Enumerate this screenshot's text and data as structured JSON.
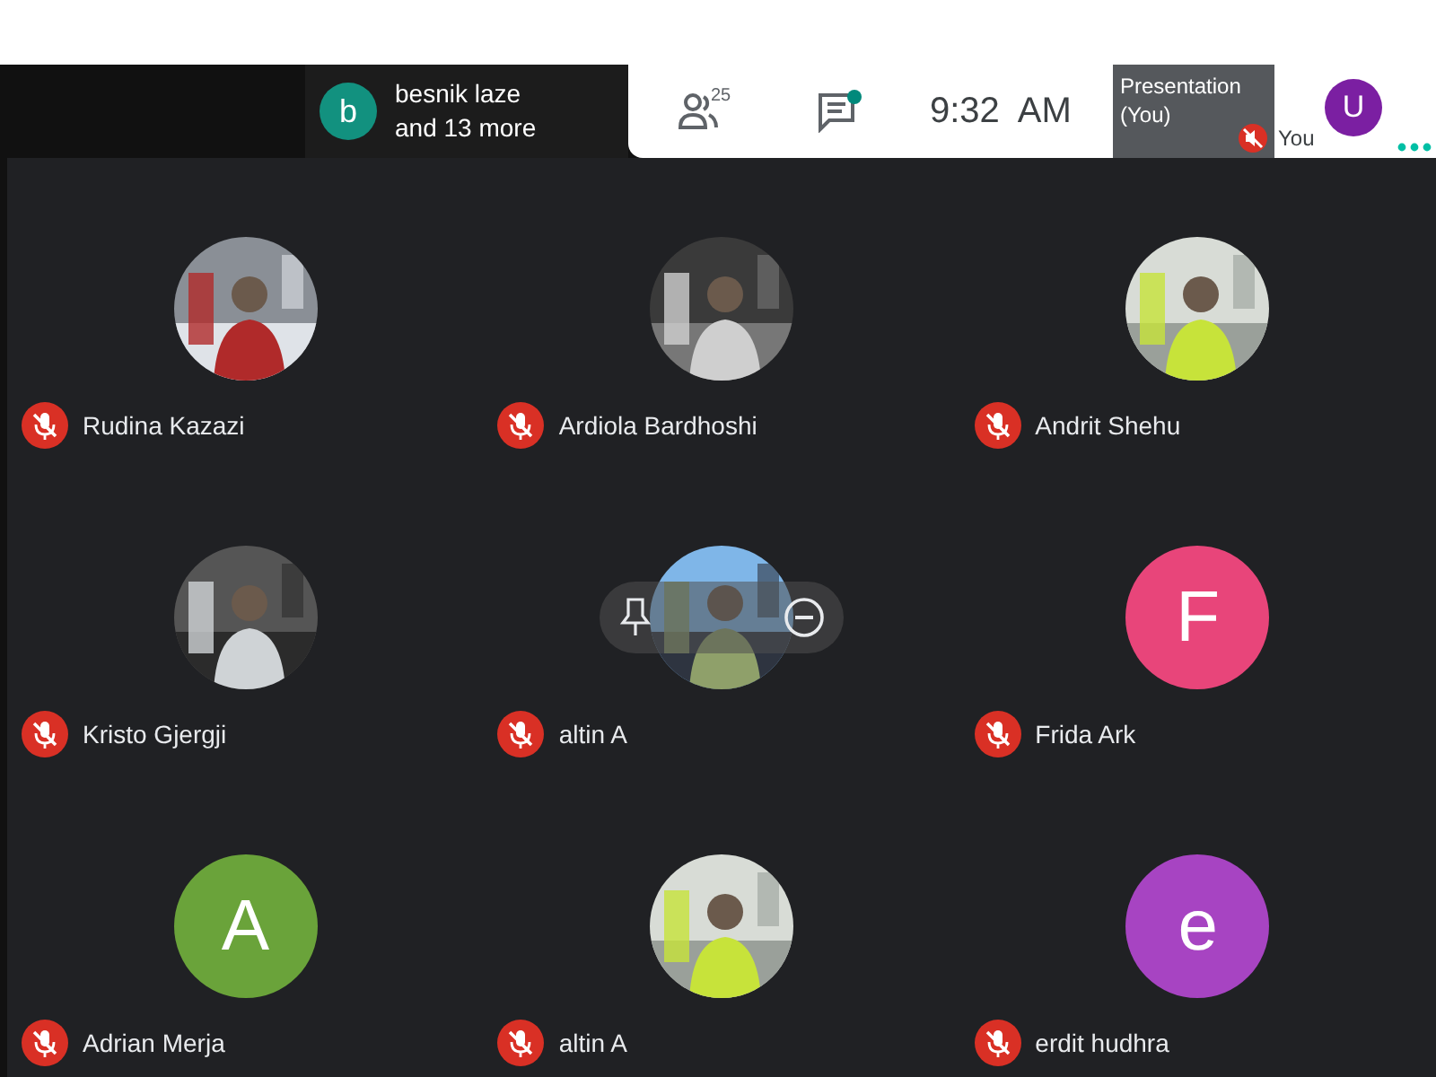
{
  "top_bar": {
    "presenter": {
      "initial": "b",
      "color": "#12917f",
      "line1": "besnik laze",
      "line2": "and 13 more"
    },
    "people_count": "25",
    "chat_unread": true,
    "time": "9:32  AM",
    "presentation": {
      "label": "Presentation\n(You)",
      "muted": true
    },
    "self": {
      "initial": "U",
      "color": "#7b1fa2",
      "label": "You"
    }
  },
  "participants": [
    {
      "name": "Rudina Kazazi",
      "muted": true,
      "hovered": false
    },
    {
      "name": "Ardiola Bardhoshi",
      "muted": true,
      "hovered": false
    },
    {
      "name": "Andrit Shehu",
      "muted": true,
      "hovered": false
    },
    {
      "name": "Kristo Gjergji",
      "muted": true,
      "hovered": false
    },
    {
      "name": "altin A",
      "muted": true,
      "hovered": true
    },
    {
      "name": "Frida Ark",
      "muted": true,
      "avatar": {
        "kind": "letter",
        "letter": "F",
        "color": "#e8457a"
      },
      "hovered": false
    },
    {
      "name": "Adrian Merja",
      "muted": true,
      "avatar": {
        "kind": "letter",
        "letter": "A",
        "color": "#6aa33a"
      },
      "hovered": false
    },
    {
      "name": "altin A",
      "muted": true,
      "hovered": false
    },
    {
      "name": "erdit hudhra",
      "muted": true,
      "avatar": {
        "kind": "letter",
        "letter": "e",
        "color": "#a744c2"
      },
      "hovered": false
    }
  ]
}
